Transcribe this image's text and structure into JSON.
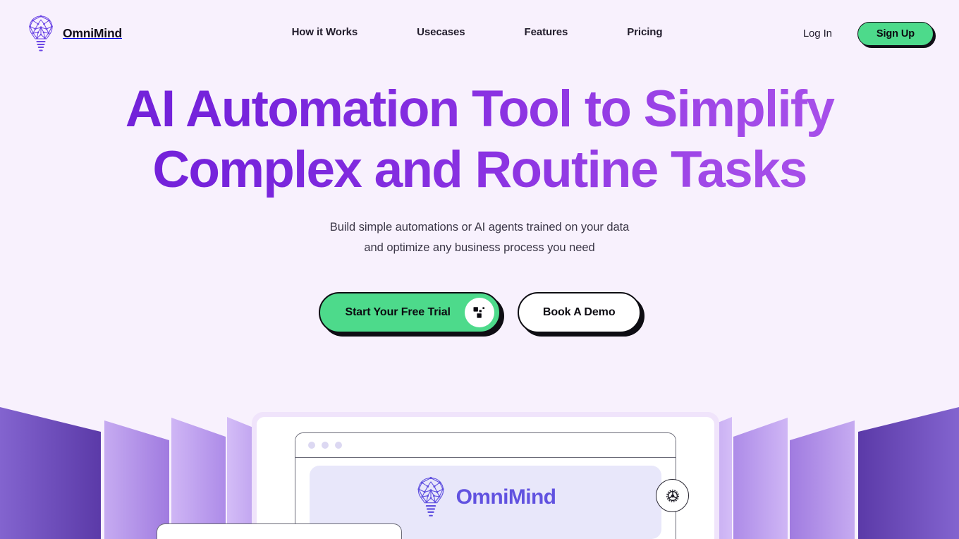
{
  "brand": {
    "name": "OmniMind",
    "logo_icon": "lightbulb-network-icon"
  },
  "header": {
    "nav": [
      {
        "label": "How it Works"
      },
      {
        "label": "Usecases"
      },
      {
        "label": "Features"
      },
      {
        "label": "Pricing"
      }
    ],
    "login_label": "Log In",
    "signup_label": "Sign Up"
  },
  "hero": {
    "headline_line1": "AI Automation Tool to Simplify",
    "headline_line2": "Complex and Routine Tasks",
    "subtitle_line1": "Build simple automations or AI agents trained on your data",
    "subtitle_line2": "and optimize any business process you need",
    "primary_cta_label": "Start Your Free Trial",
    "primary_cta_icon": "pixel-arrow-icon",
    "secondary_cta_label": "Book A Demo"
  },
  "mockup": {
    "logo_icon": "lightbulb-network-icon",
    "brand_name": "OmniMind",
    "gear_icon": "gear-icon",
    "traffic_lights": 3
  },
  "colors": {
    "background": "#F8F1FD",
    "accent_green": "#4DDA8B",
    "headline_gradient_start": "#6E1FD6",
    "headline_gradient_end": "#AE57EC",
    "panel_purple_dark": "#6D4BC4",
    "panel_purple_light": "#C9AEF2",
    "ink": "#0E0D13",
    "inner_logo_purple": "#6152E0"
  }
}
